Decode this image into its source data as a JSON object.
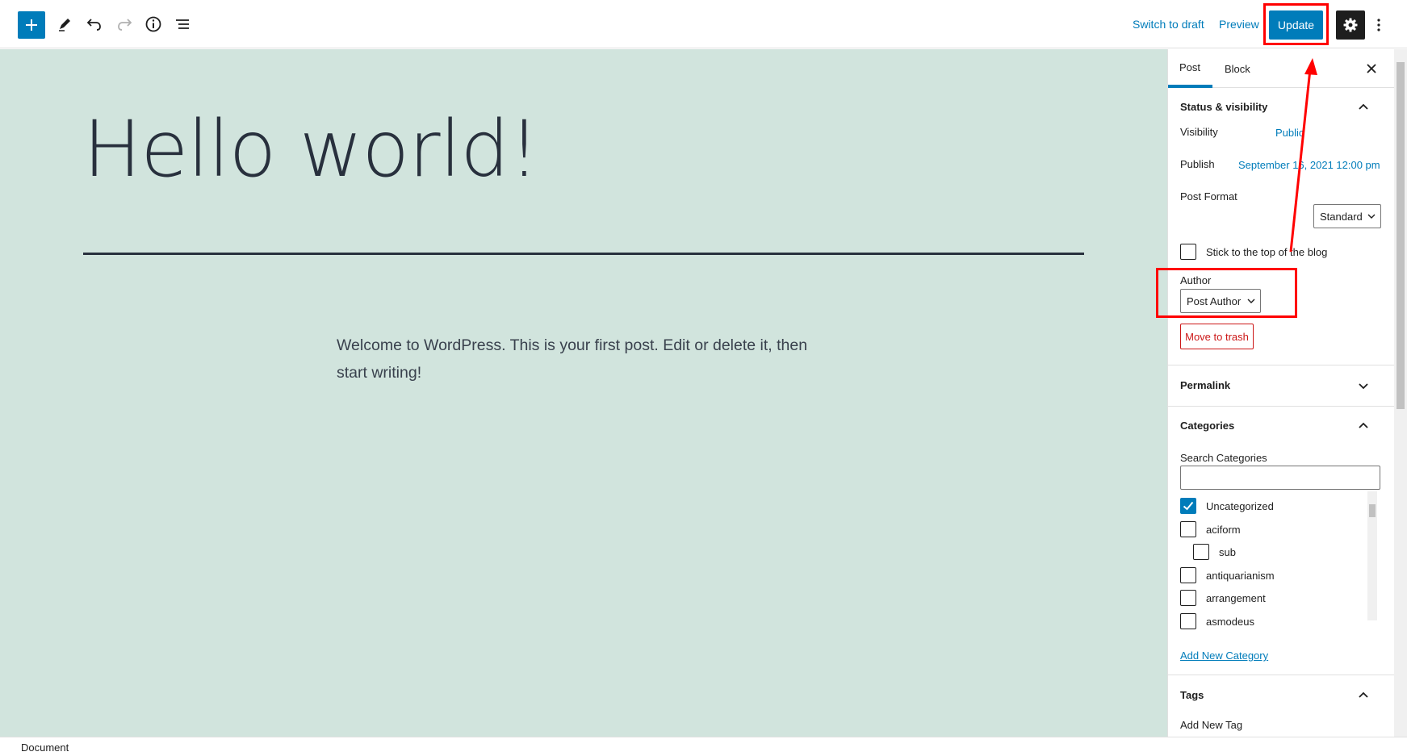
{
  "toolbar": {
    "switch_to_draft": "Switch to draft",
    "preview": "Preview",
    "update": "Update"
  },
  "post": {
    "title": "Hello world!",
    "paragraph": "Welcome to WordPress. This is your first post. Edit or delete it, then start writing!"
  },
  "status_bar": {
    "label": "Document"
  },
  "sidebar": {
    "tabs": [
      {
        "label": "Post"
      },
      {
        "label": "Block"
      }
    ],
    "status_visibility": {
      "title": "Status & visibility",
      "visibility_label": "Visibility",
      "visibility_value": "Public",
      "publish_label": "Publish",
      "publish_value": "September 16, 2021 12:00 pm",
      "post_format_label": "Post Format",
      "post_format_value": "Standard",
      "sticky_label": "Stick to the top of the blog",
      "author_label": "Author",
      "author_value": "Post Author",
      "trash": "Move to trash"
    },
    "permalink": {
      "title": "Permalink"
    },
    "categories": {
      "title": "Categories",
      "search_label": "Search Categories",
      "items": [
        {
          "label": "Uncategorized",
          "checked": true
        },
        {
          "label": "aciform",
          "checked": false
        },
        {
          "label": "sub",
          "checked": false
        },
        {
          "label": "antiquarianism",
          "checked": false
        },
        {
          "label": "arrangement",
          "checked": false
        },
        {
          "label": "asmodeus",
          "checked": false
        }
      ],
      "add_new": "Add New Category"
    },
    "tags": {
      "title": "Tags",
      "add_new_label": "Add New Tag"
    }
  },
  "colors": {
    "accent": "#007cba",
    "canvas_bg": "#d1e4dd",
    "highlight": "#ff0000",
    "danger": "#cc1818"
  }
}
